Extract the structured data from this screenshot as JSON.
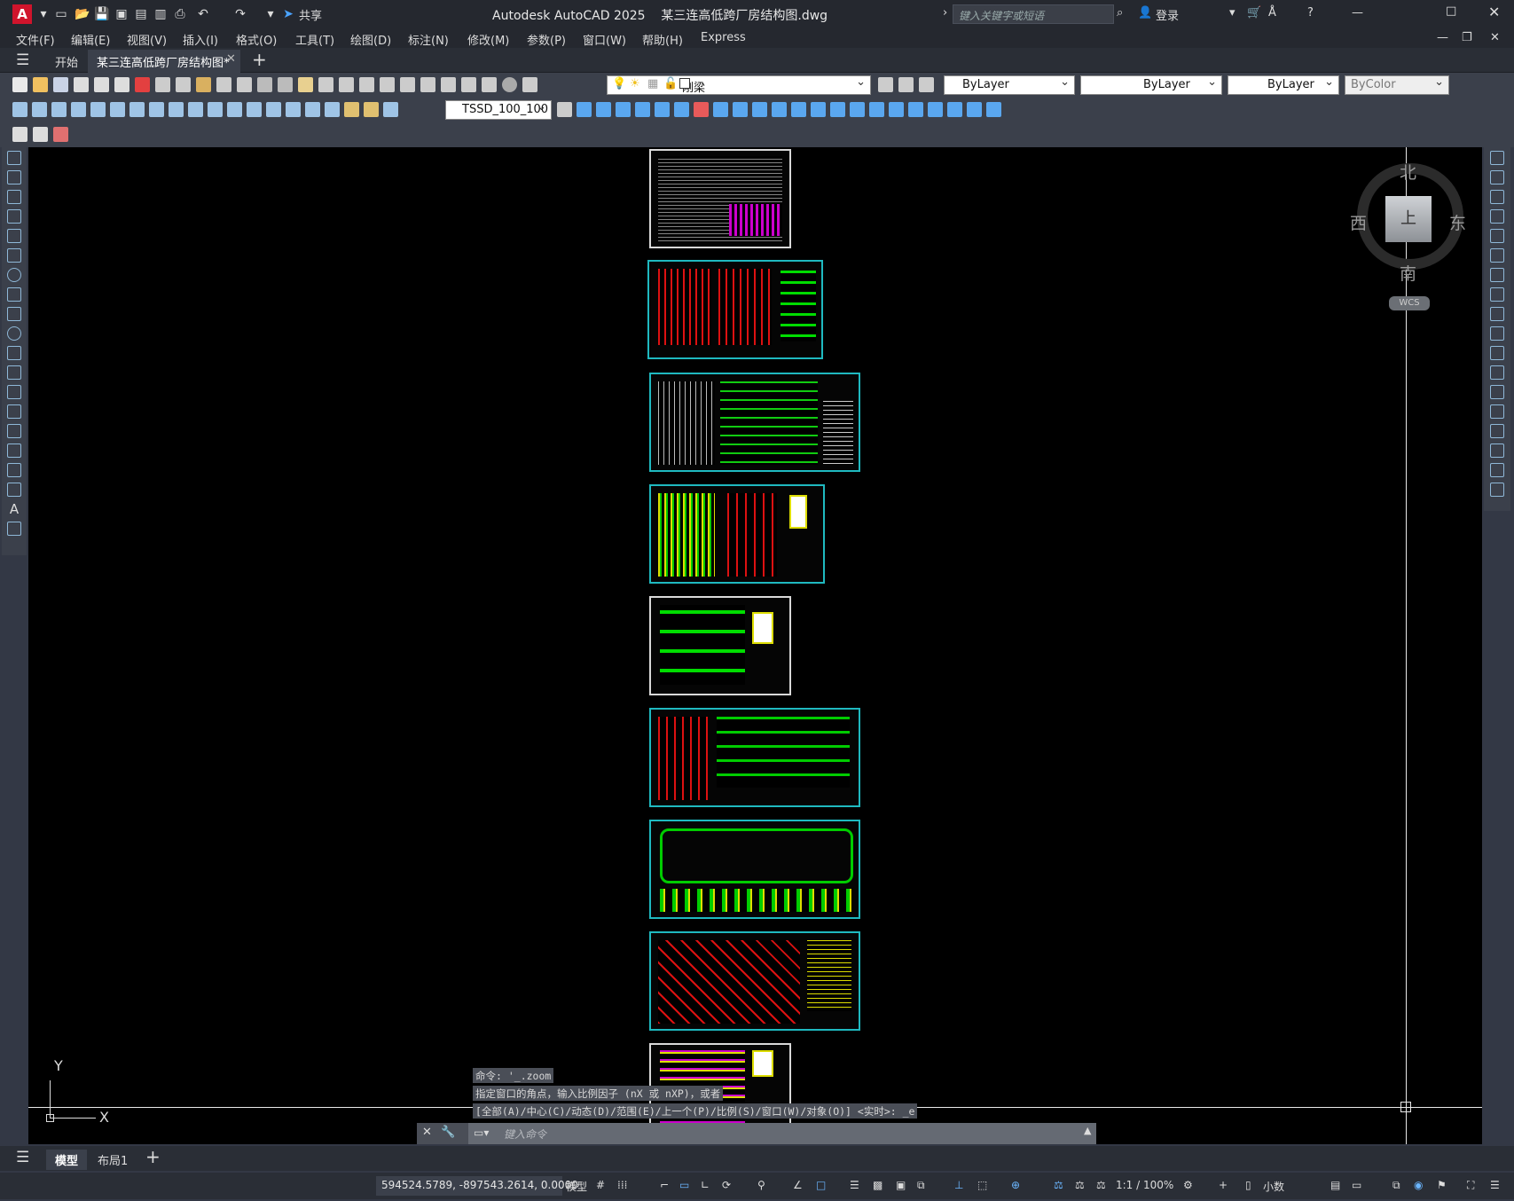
{
  "app": {
    "logo_letter": "A",
    "title": "Autodesk AutoCAD 2025",
    "filename": "某三连高低跨厂房结构图.dwg",
    "share_label": "共享",
    "search_placeholder": "键入关键字或短语",
    "login_label": "登录"
  },
  "menu": [
    "文件(F)",
    "编辑(E)",
    "视图(V)",
    "插入(I)",
    "格式(O)",
    "工具(T)",
    "绘图(D)",
    "标注(N)",
    "修改(M)",
    "参数(P)",
    "窗口(W)",
    "帮助(H)",
    "Express"
  ],
  "file_tabs": {
    "start": "开始",
    "drawing": "某三连高低跨厂房结构图*"
  },
  "toolbar": {
    "layer_name": "刚梁",
    "color": "ByLayer",
    "linetype": "ByLayer",
    "lineweight": "ByLayer",
    "plotstyle": "ByColor",
    "dimstyle": "TSSD_100_100"
  },
  "viewcube": {
    "north": "北",
    "south": "南",
    "east": "东",
    "west": "西",
    "face": "上",
    "wcs": "WCS"
  },
  "ucs": {
    "y": "Y",
    "x": "X"
  },
  "command": {
    "history": [
      "命令: '_.zoom",
      "指定窗口的角点，输入比例因子 (nX 或 nXP)，或者",
      "[全部(A)/中心(C)/动态(D)/范围(E)/上一个(P)/比例(S)/窗口(W)/对象(O)] <实时>: _e"
    ],
    "placeholder": "键入命令"
  },
  "layout_tabs": {
    "model": "模型",
    "layout1": "布局1"
  },
  "status": {
    "coordinates": "594524.5789, -897543.2614, 0.0000",
    "model": "模型",
    "scale": "1:1 / 100%",
    "units": "小数"
  },
  "colors": {
    "canvas": "#000000",
    "sheet_border": "#1fb9c0",
    "ui_dark": "#2a2e36",
    "ui_panel": "#3b404b"
  }
}
